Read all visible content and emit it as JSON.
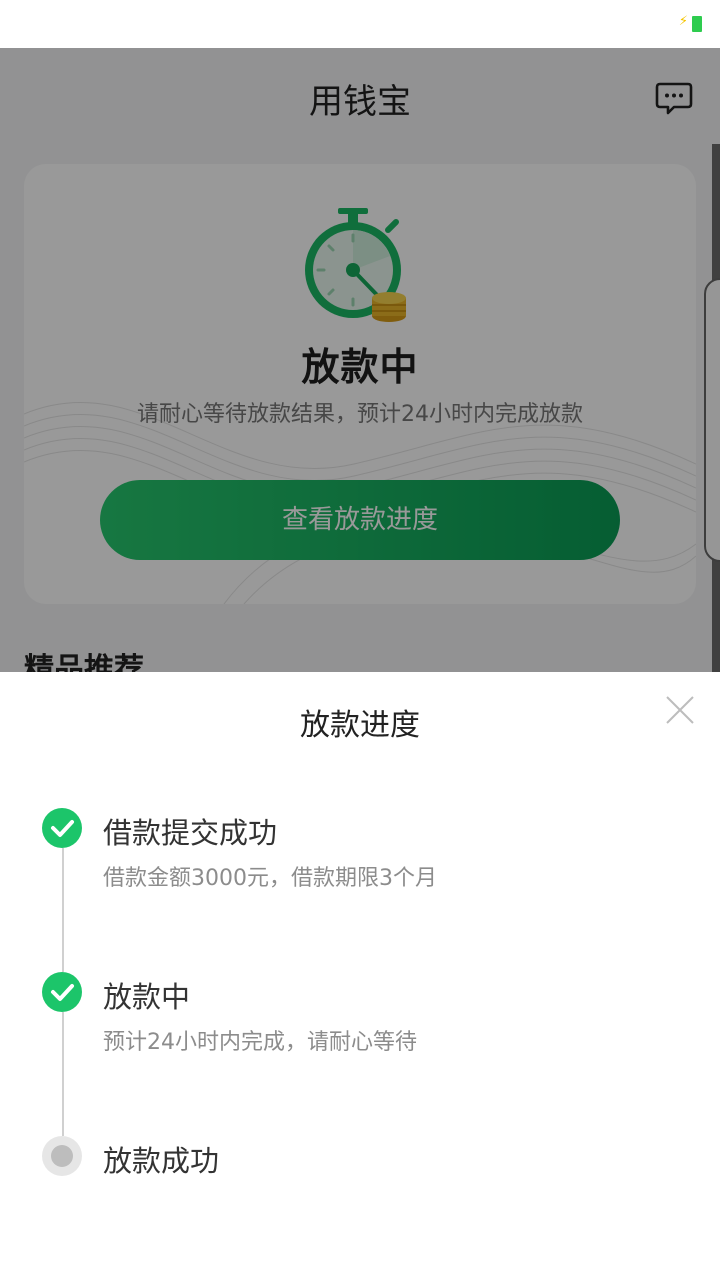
{
  "statusbar": {
    "charging_icon": "bolt-icon",
    "battery_icon": "battery-icon"
  },
  "header": {
    "title": "用钱宝",
    "message_icon": "chat-bubble-icon"
  },
  "card": {
    "status_title": "放款中",
    "status_desc": "请耐心等待放款结果，预计24小时内完成放款",
    "progress_button": "查看放款进度",
    "illustration": "stopwatch-coins-icon"
  },
  "recommend_title": "精品推荐",
  "sheet": {
    "title": "放款进度",
    "close_icon": "close-icon",
    "steps": [
      {
        "title": "借款提交成功",
        "desc": "借款金额3000元，借款期限3个月",
        "status": "done"
      },
      {
        "title": "放款中",
        "desc": "预计24小时内完成，请耐心等待",
        "status": "done"
      },
      {
        "title": "放款成功",
        "desc": "",
        "status": "pending"
      }
    ]
  },
  "colors": {
    "accent": "#1cc56a",
    "button_gradient_start": "#27c76e",
    "button_gradient_end": "#0a9c55"
  }
}
